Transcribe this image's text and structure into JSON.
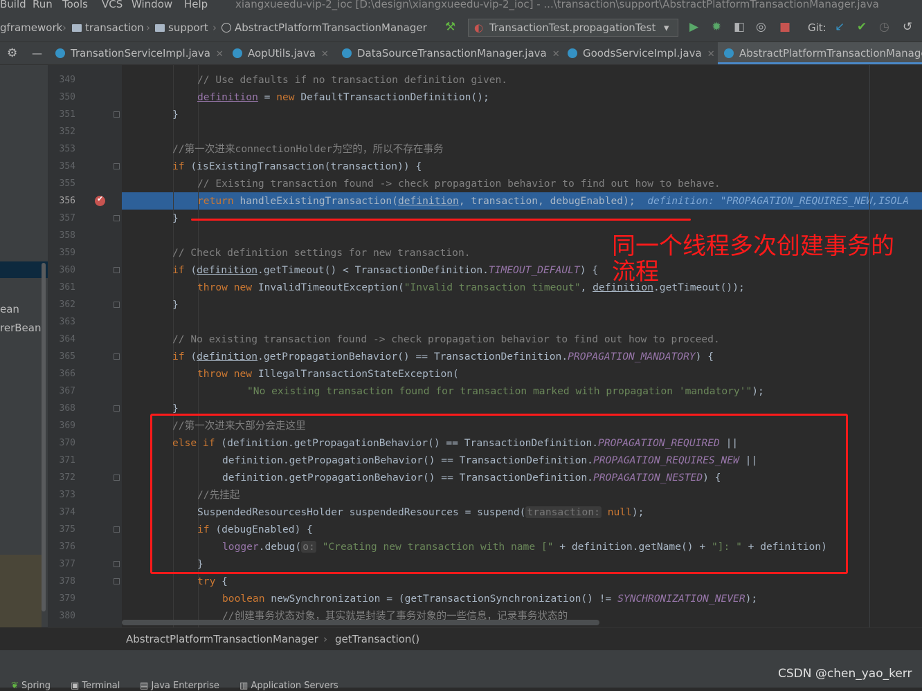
{
  "menu": {
    "items": [
      "Build",
      "Run",
      "Tools",
      "VCS",
      "Window",
      "Help"
    ],
    "title": "xiangxueedu-vip-2_ioc [D:\\design\\xiangxueedu-vip-2_ioc] - ...\\transaction\\support\\AbstractPlatformTransactionManager.java"
  },
  "nav": {
    "crumbs": [
      "gframework",
      "transaction",
      "support",
      "AbstractPlatformTransactionManager"
    ],
    "run_config": "TransactionTest.propagationTest",
    "git_label": "Git:"
  },
  "tabs": [
    {
      "label": "TransationServiceImpl.java"
    },
    {
      "label": "AopUtils.java"
    },
    {
      "label": "DataSourceTransactionManager.java"
    },
    {
      "label": "GoodsServiceImpl.java"
    },
    {
      "label": "AbstractPlatformTransactionManage"
    }
  ],
  "left_panel": {
    "items": [
      "ean",
      "rerBean"
    ]
  },
  "line_numbers": [
    "349",
    "350",
    "351",
    "352",
    "353",
    "354",
    "355",
    "356",
    "357",
    "358",
    "359",
    "360",
    "361",
    "362",
    "363",
    "364",
    "365",
    "366",
    "367",
    "368",
    "369",
    "370",
    "371",
    "372",
    "373",
    "374",
    "375",
    "376",
    "377",
    "378",
    "379",
    "380"
  ],
  "code": {
    "l349": "// Use defaults if no transaction definition given.",
    "l350a": "definition",
    "l350b": " = ",
    "l350c": "new",
    "l350d": " DefaultTransactionDefinition();",
    "l351": "}",
    "l353": "//第一次进来connectionHolder为空的，所以不存在事务",
    "l354a": "if",
    "l354b": " (isExistingTransaction(transaction)) {",
    "l355": "// Existing transaction found -> check propagation behavior to find out how to behave.",
    "l356a": "return",
    "l356b": " handleExistingTransaction(",
    "l356c": "definition",
    "l356d": ", transaction, debugEnabled);",
    "l356hint": "definition: \"PROPAGATION_REQUIRES_NEW,ISOLA",
    "l357": "}",
    "l359": "// Check definition settings for new transaction.",
    "l360a": "if",
    "l360b": " (",
    "l360c": "definition",
    "l360d": ".getTimeout() < TransactionDefinition.",
    "l360e": "TIMEOUT_DEFAULT",
    "l360f": ") {",
    "l361a": "throw new",
    "l361b": " InvalidTimeoutException(",
    "l361c": "\"Invalid transaction timeout\"",
    "l361d": ", ",
    "l361e": "definition",
    "l361f": ".getTimeout());",
    "l362": "}",
    "l364": "// No existing transaction found -> check propagation behavior to find out how to proceed.",
    "l365a": "if",
    "l365b": " (",
    "l365c": "definition",
    "l365d": ".getPropagationBehavior() == TransactionDefinition.",
    "l365e": "PROPAGATION_MANDATORY",
    "l365f": ") {",
    "l366a": "throw new",
    "l366b": " IllegalTransactionStateException(",
    "l367a": "\"No existing transaction found for transaction marked with propagation 'mandatory'\"",
    "l367b": ");",
    "l368": "}",
    "l369": "//第一次进来大部分会走这里",
    "l370a": "else if",
    "l370b": " (definition.getPropagationBehavior() == TransactionDefinition.",
    "l370c": "PROPAGATION_REQUIRED",
    "l370d": " ||",
    "l371a": "definition.getPropagationBehavior() == TransactionDefinition.",
    "l371b": "PROPAGATION_REQUIRES_NEW",
    "l371c": " ||",
    "l372a": "definition.getPropagationBehavior() == TransactionDefinition.",
    "l372b": "PROPAGATION_NESTED",
    "l372c": ") {",
    "l373": "//先挂起",
    "l374a": "SuspendedResourcesHolder suspendedResources = suspend(",
    "l374hint": "transaction:",
    "l374b": " null",
    "l374c": ");",
    "l375a": "if",
    "l375b": " (debugEnabled) {",
    "l376a": "logger",
    "l376b": ".debug(",
    "l376hint": "o:",
    "l376c": " \"Creating new transaction with name [\"",
    "l376d": " + definition.getName() + ",
    "l376e": "\"]: \"",
    "l376f": " + definition)",
    "l377": "}",
    "l378a": "try",
    "l378b": " {",
    "l379a": "boolean",
    "l379b": " newSynchronization = (getTransactionSynchronization() != ",
    "l379c": "SYNCHRONIZATION_NEVER",
    "l379d": ");",
    "l380": "//创建事务状态对象，其实就是封装了事务对象的一些信息，记录事务状态的"
  },
  "breadcrumb": {
    "class": "AbstractPlatformTransactionManager",
    "method": "getTransaction()"
  },
  "bottom_tools": [
    "Spring",
    "Terminal",
    "Java Enterprise",
    "Application Servers"
  ],
  "annotation": {
    "text": "同一个线程多次创建事务的流程"
  },
  "watermark": "CSDN @chen_yao_kerr",
  "colors": {
    "highlight": "#2d6099",
    "annotation": "#ff1a1a",
    "keyword": "#cc7832",
    "string": "#6a8759",
    "comment": "#808080",
    "constant": "#9876aa"
  }
}
